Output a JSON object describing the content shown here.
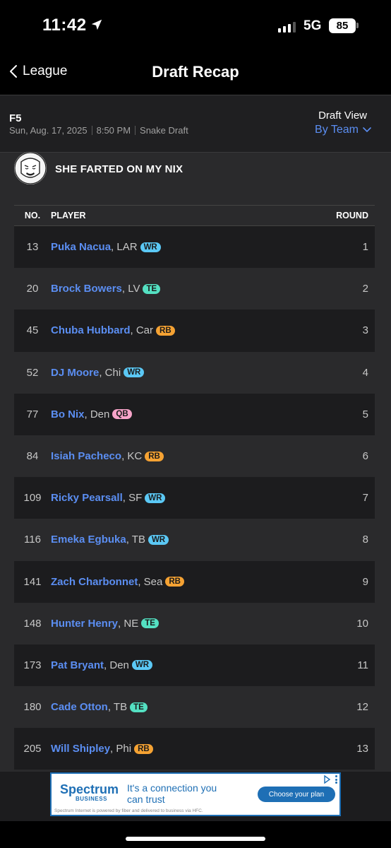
{
  "status_bar": {
    "time": "11:42",
    "network": "5G",
    "battery": "85"
  },
  "nav": {
    "back_label": "League",
    "title": "Draft Recap"
  },
  "draft_info": {
    "league": "F5",
    "date": "Sun, Aug. 17, 2025",
    "time": "8:50 PM",
    "type": "Snake Draft",
    "view_label": "Draft View",
    "view_value": "By Team"
  },
  "team": {
    "name": "SHE FARTED ON MY NIX"
  },
  "table": {
    "headers": {
      "no": "NO.",
      "player": "PLAYER",
      "round": "ROUND"
    },
    "rows": [
      {
        "no": "13",
        "name": "Puka Nacua",
        "team": ", LAR",
        "pos": "WR",
        "round": "1"
      },
      {
        "no": "20",
        "name": "Brock Bowers",
        "team": ", LV",
        "pos": "TE",
        "round": "2"
      },
      {
        "no": "45",
        "name": "Chuba Hubbard",
        "team": ", Car",
        "pos": "RB",
        "round": "3"
      },
      {
        "no": "52",
        "name": "DJ Moore",
        "team": ", Chi",
        "pos": "WR",
        "round": "4"
      },
      {
        "no": "77",
        "name": "Bo Nix",
        "team": ", Den",
        "pos": "QB",
        "round": "5"
      },
      {
        "no": "84",
        "name": "Isiah Pacheco",
        "team": ", KC",
        "pos": "RB",
        "round": "6"
      },
      {
        "no": "109",
        "name": "Ricky Pearsall",
        "team": ", SF",
        "pos": "WR",
        "round": "7"
      },
      {
        "no": "116",
        "name": "Emeka Egbuka",
        "team": ", TB",
        "pos": "WR",
        "round": "8"
      },
      {
        "no": "141",
        "name": "Zach Charbonnet",
        "team": ", Sea",
        "pos": "RB",
        "round": "9"
      },
      {
        "no": "148",
        "name": "Hunter Henry",
        "team": ", NE",
        "pos": "TE",
        "round": "10"
      },
      {
        "no": "173",
        "name": "Pat Bryant",
        "team": ", Den",
        "pos": "WR",
        "round": "11"
      },
      {
        "no": "180",
        "name": "Cade Otton",
        "team": ", TB",
        "pos": "TE",
        "round": "12"
      },
      {
        "no": "205",
        "name": "Will Shipley",
        "team": ", Phi",
        "pos": "RB",
        "round": "13"
      }
    ]
  },
  "position_colors": {
    "WR": "#5bc8f5",
    "TE": "#54e0c2",
    "RB": "#f5a233",
    "QB": "#f7a4c9"
  },
  "ad": {
    "brand": "Spectrum",
    "brand_sub": "BUSINESS",
    "tagline": "It's a connection you can trust",
    "cta": "Choose your plan",
    "footnote": "Spectrum Internet is powered by fiber and delivered to business via HFC."
  },
  "colors": {
    "accent": "#5b8ef2",
    "background": "#000000",
    "panel": "#2a2a2c"
  },
  "icons": [
    "location-arrow-icon",
    "signal-icon",
    "battery-icon",
    "chevron-left-icon",
    "chevron-down-icon",
    "team-avatar",
    "ad-choices-icon"
  ]
}
